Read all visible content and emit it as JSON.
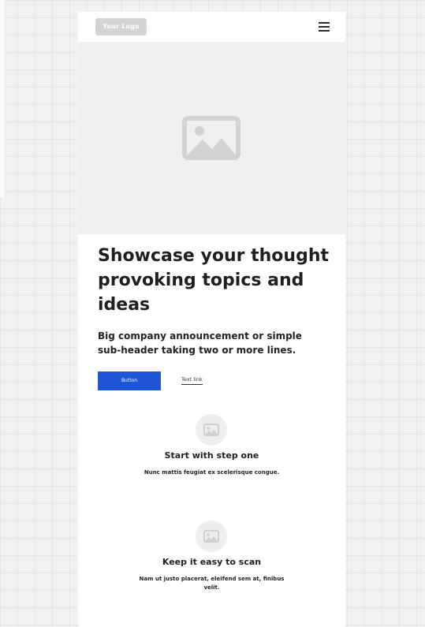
{
  "header": {
    "logo_text": "Your Logo",
    "menu_icon": "hamburger-menu-icon"
  },
  "hero": {
    "image_icon": "image-placeholder-icon",
    "headline": "Showcase your thought provoking topics and ideas",
    "subheader": "Big company announcement or simple sub-header taking two or more lines."
  },
  "actions": {
    "button_label": "Button",
    "link_label": "Text link",
    "button_color": "#1f55d6"
  },
  "features": [
    {
      "icon": "image-placeholder-icon",
      "title": "Start with step one",
      "text": "Nunc mattis feugiat ex scelerisque congue."
    },
    {
      "icon": "image-placeholder-icon",
      "title": "Keep it easy to scan",
      "text": "Nam ut justo placerat, eleifend sem at, finibus velit."
    }
  ]
}
